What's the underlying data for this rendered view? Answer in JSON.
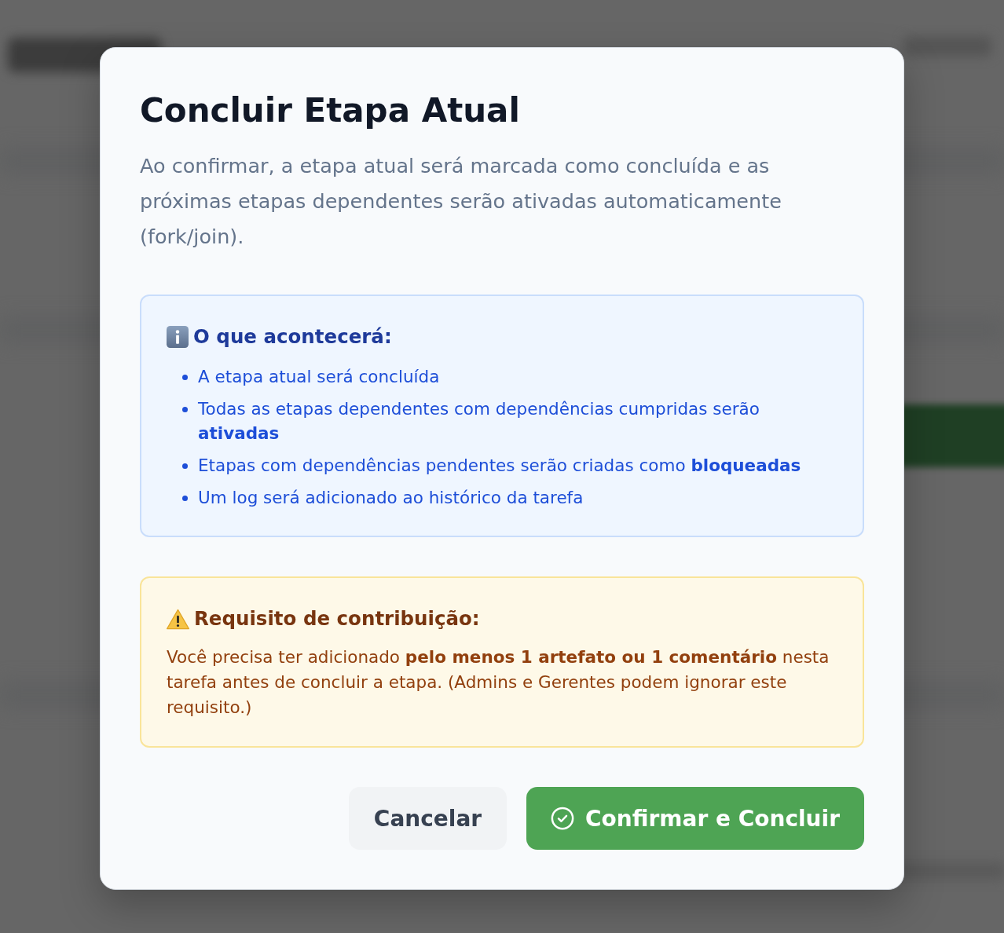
{
  "dialog": {
    "title": "Concluir Etapa Atual",
    "description": "Ao confirmar, a etapa atual será marcada como concluída e as próximas etapas dependentes serão ativadas automaticamente (fork/join)."
  },
  "callouts": [
    {
      "kind": "info",
      "heading": "O que acontecerá:",
      "items": [
        "A etapa atual será concluída",
        "Todas as etapas dependentes com dependências cumpridas serão **ativadas**",
        "Etapas com dependências pendentes serão criadas como **bloqueadas**",
        "Um log será adicionado ao histórico da tarefa"
      ]
    },
    {
      "kind": "warning",
      "heading": "Requisito de contribuição:",
      "text": "Você precisa ter adicionado **pelo menos 1 artefato ou 1 comentário** nesta tarefa antes de concluir a etapa. (Admins e Gerentes podem ignorar este requisito.)"
    }
  ],
  "buttons": [
    {
      "kind": "secondary",
      "label": "Cancelar"
    },
    {
      "kind": "primary",
      "label": "Confirmar e Concluir"
    }
  ]
}
